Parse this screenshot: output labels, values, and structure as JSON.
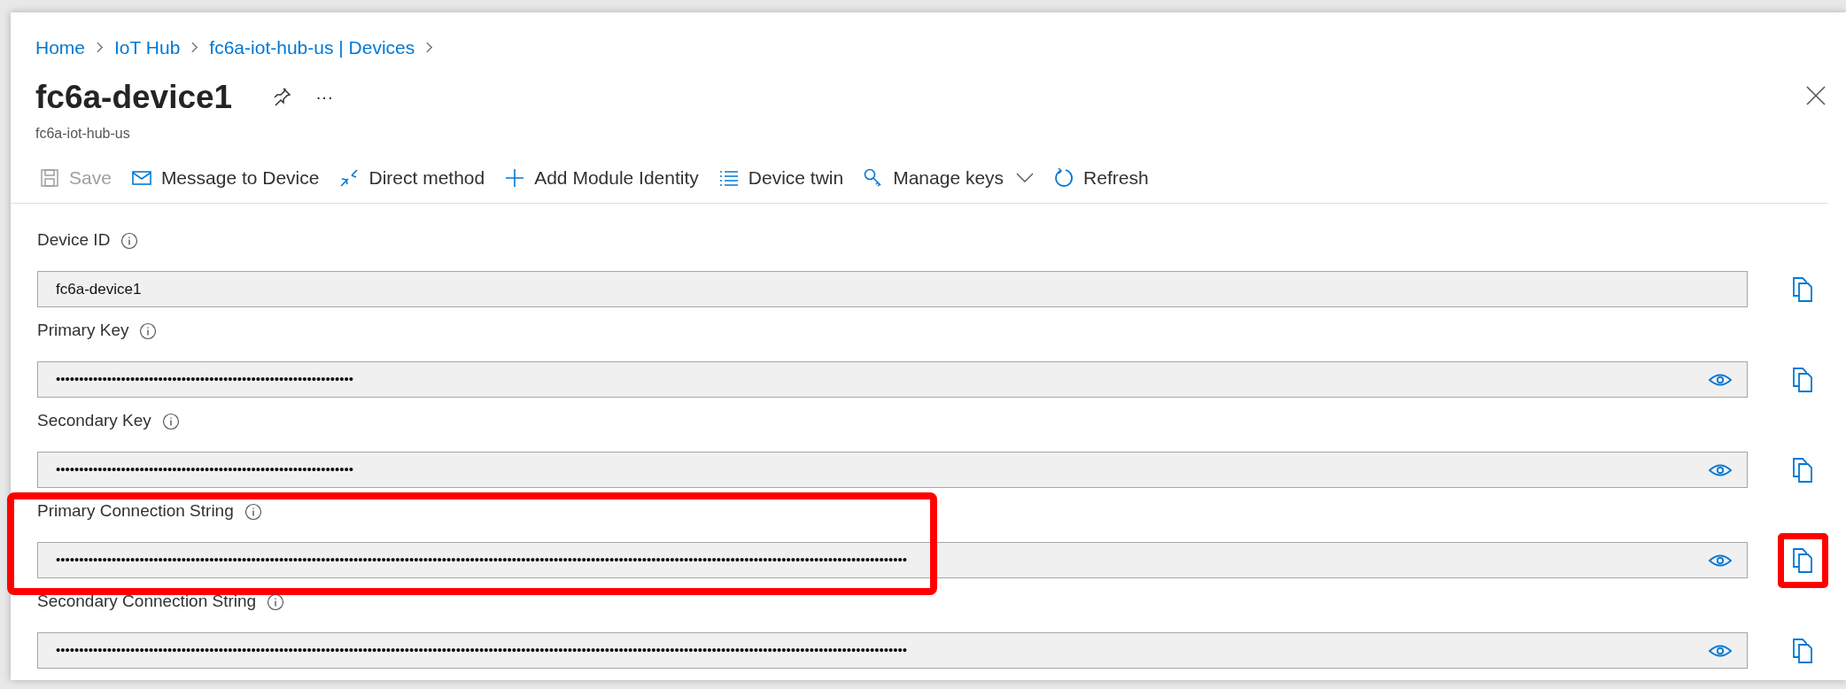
{
  "breadcrumb": [
    "Home",
    "IoT Hub",
    "fc6a-iot-hub-us | Devices"
  ],
  "title": "fc6a-device1",
  "subtitle": "fc6a-iot-hub-us",
  "more": "···",
  "toolbar": [
    {
      "kind": "save",
      "label": "Save",
      "disabled": true
    },
    {
      "kind": "message",
      "label": "Message to Device",
      "disabled": false
    },
    {
      "kind": "method",
      "label": "Direct method",
      "disabled": false
    },
    {
      "kind": "add",
      "label": "Add Module Identity",
      "disabled": false
    },
    {
      "kind": "twin",
      "label": "Device twin",
      "disabled": false
    },
    {
      "kind": "keys",
      "label": "Manage keys",
      "disabled": false,
      "dropdown": true
    },
    {
      "kind": "refresh",
      "label": "Refresh",
      "disabled": false
    }
  ],
  "fields": [
    {
      "label": "Device ID",
      "value": "fc6a-device1",
      "masked": false,
      "highlighted": false,
      "copy_highlighted": false
    },
    {
      "label": "Primary Key",
      "value": "••••••••••••••••••••••••••••••••••••••••••••••••••••••••••••••••",
      "masked": true,
      "highlighted": false,
      "copy_highlighted": false
    },
    {
      "label": "Secondary Key",
      "value": "••••••••••••••••••••••••••••••••••••••••••••••••••••••••••••••••",
      "masked": true,
      "highlighted": false,
      "copy_highlighted": false
    },
    {
      "label": "Primary Connection String",
      "value": "•••••••••••••••••••••••••••••••••••••••••••••••••••••••••••••••••••••••••••••••••••••••••••••••••••••••••••••••••••••••••••••••••••••••••••••••••••••••••••••••••••••••••••••••••••••••",
      "masked": true,
      "highlighted": true,
      "copy_highlighted": true
    },
    {
      "label": "Secondary Connection String",
      "value": "•••••••••••••••••••••••••••••••••••••••••••••••••••••••••••••••••••••••••••••••••••••••••••••••••••••••••••••••••••••••••••••••••••••••••••••••••••••••••••••••••••••••••••••••••••••••",
      "masked": true,
      "highlighted": false,
      "copy_highlighted": false
    }
  ]
}
